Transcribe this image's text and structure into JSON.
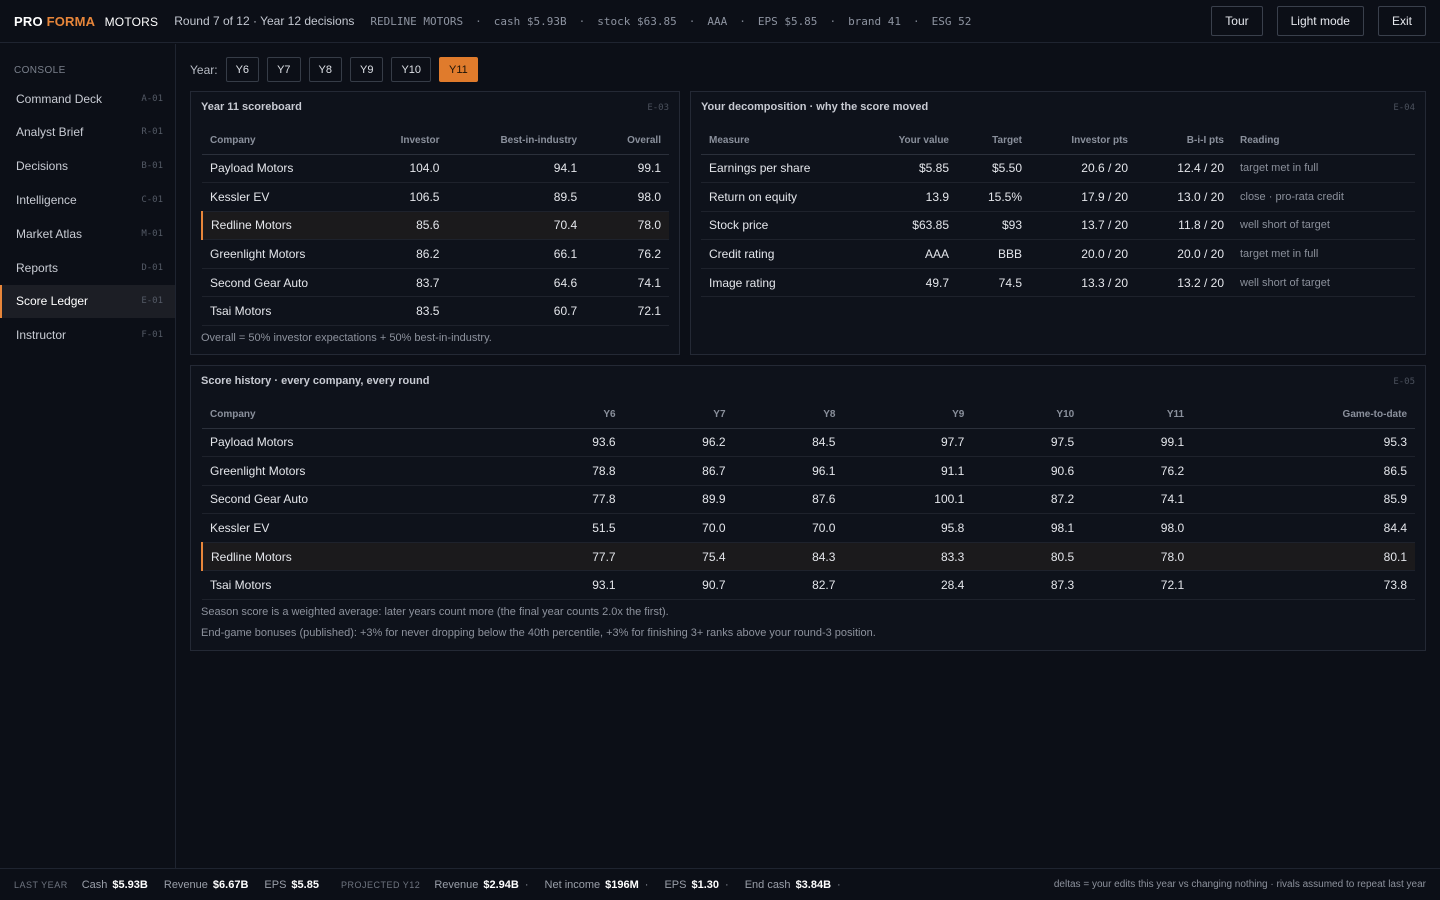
{
  "header": {
    "brand_pro": "PRO",
    "brand_forma": "FORMA",
    "brand_sub": "MOTORS",
    "round": "Round 7 of 12 · Year 12 decisions",
    "stats": [
      "REDLINE MOTORS",
      "cash $5.93B",
      "stock $63.85",
      "AAA",
      "EPS $5.85",
      "brand 41",
      "ESG 52"
    ],
    "stat_separator": "·",
    "buttons": {
      "tour": "Tour",
      "light_mode": "Light mode",
      "exit": "Exit"
    }
  },
  "sidebar": {
    "section_label": "CONSOLE",
    "items": [
      {
        "label": "Command Deck",
        "code": "A-01"
      },
      {
        "label": "Analyst Brief",
        "code": "R-01"
      },
      {
        "label": "Decisions",
        "code": "B-01"
      },
      {
        "label": "Intelligence",
        "code": "C-01"
      },
      {
        "label": "Market Atlas",
        "code": "M-01"
      },
      {
        "label": "Reports",
        "code": "D-01"
      },
      {
        "label": "Score Ledger",
        "code": "E-01"
      },
      {
        "label": "Instructor",
        "code": "F-01"
      }
    ],
    "active_item": "Score Ledger"
  },
  "year_selector": {
    "label": "Year:",
    "years": [
      "Y6",
      "Y7",
      "Y8",
      "Y9",
      "Y10",
      "Y11"
    ],
    "selected": "Y11"
  },
  "scoreboard": {
    "title": "Year 11 scoreboard",
    "code": "E-03",
    "columns": [
      "Company",
      "Investor",
      "Best-in-industry",
      "Overall"
    ],
    "rows": [
      [
        "Payload Motors",
        "104.0",
        "94.1",
        "99.1"
      ],
      [
        "Kessler EV",
        "106.5",
        "89.5",
        "98.0"
      ],
      [
        "Redline Motors",
        "85.6",
        "70.4",
        "78.0"
      ],
      [
        "Greenlight Motors",
        "86.2",
        "66.1",
        "76.2"
      ],
      [
        "Second Gear Auto",
        "83.7",
        "64.6",
        "74.1"
      ],
      [
        "Tsai Motors",
        "83.5",
        "60.7",
        "72.1"
      ]
    ],
    "highlight_row": "Redline Motors",
    "note": "Overall = 50% investor expectations + 50% best-in-industry."
  },
  "decomposition": {
    "title": "Your decomposition · why the score moved",
    "code": "E-04",
    "columns": [
      "Measure",
      "Your value",
      "Target",
      "Investor pts",
      "B-i-I pts",
      "Reading"
    ],
    "rows": [
      [
        "Earnings per share",
        "$5.85",
        "$5.50",
        "20.6 / 20",
        "12.4 / 20",
        "target met in full"
      ],
      [
        "Return on equity",
        "13.9",
        "15.5%",
        "17.9 / 20",
        "13.0 / 20",
        "close · pro-rata credit"
      ],
      [
        "Stock price",
        "$63.85",
        "$93",
        "13.7 / 20",
        "11.8 / 20",
        "well short of target"
      ],
      [
        "Credit rating",
        "AAA",
        "BBB",
        "20.0 / 20",
        "20.0 / 20",
        "target met in full"
      ],
      [
        "Image rating",
        "49.7",
        "74.5",
        "13.3 / 20",
        "13.2 / 20",
        "well short of target"
      ]
    ]
  },
  "history": {
    "title": "Score history · every company, every round",
    "code": "E-05",
    "columns": [
      "Company",
      "Y6",
      "Y7",
      "Y8",
      "Y9",
      "Y10",
      "Y11",
      "Game-to-date"
    ],
    "rows": [
      [
        "Payload Motors",
        "93.6",
        "96.2",
        "84.5",
        "97.7",
        "97.5",
        "99.1",
        "95.3"
      ],
      [
        "Greenlight Motors",
        "78.8",
        "86.7",
        "96.1",
        "91.1",
        "90.6",
        "76.2",
        "86.5"
      ],
      [
        "Second Gear Auto",
        "77.8",
        "89.9",
        "87.6",
        "100.1",
        "87.2",
        "74.1",
        "85.9"
      ],
      [
        "Kessler EV",
        "51.5",
        "70.0",
        "70.0",
        "95.8",
        "98.1",
        "98.0",
        "84.4"
      ],
      [
        "Redline Motors",
        "77.7",
        "75.4",
        "84.3",
        "83.3",
        "80.5",
        "78.0",
        "80.1"
      ],
      [
        "Tsai Motors",
        "93.1",
        "90.7",
        "82.7",
        "28.4",
        "87.3",
        "72.1",
        "73.8"
      ]
    ],
    "highlight_row": "Redline Motors",
    "notes": [
      "Season score is a weighted average: later years count more (the final year counts 2.0x the first).",
      "End-game bonuses (published): +3% for never dropping below the 40th percentile, +3% for finishing 3+ ranks above your round-3 position."
    ]
  },
  "footer": {
    "last_year_label": "LAST YEAR",
    "last_year": [
      {
        "label": "Cash",
        "value": "$5.93B"
      },
      {
        "label": "Revenue",
        "value": "$6.67B"
      },
      {
        "label": "EPS",
        "value": "$5.85"
      }
    ],
    "projected_label": "PROJECTED Y12",
    "projected": [
      {
        "label": "Revenue",
        "value": "$2.94B"
      },
      {
        "label": "Net income",
        "value": "$196M"
      },
      {
        "label": "EPS",
        "value": "$1.30"
      },
      {
        "label": "End cash",
        "value": "$3.84B"
      }
    ],
    "note": "deltas = your edits this year vs changing nothing · rivals assumed to repeat last year"
  },
  "colors": {
    "accent": "#e8863a",
    "background": "#0c0f17",
    "panel": "#0e121b"
  }
}
